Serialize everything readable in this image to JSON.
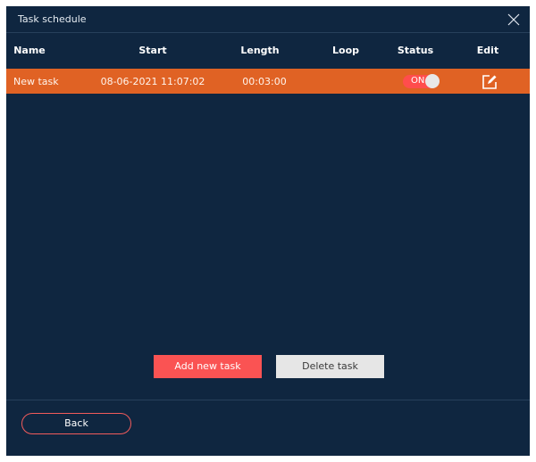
{
  "window": {
    "title": "Task schedule",
    "close_icon": "close-icon"
  },
  "table": {
    "columns": [
      "Name",
      "Start",
      "Length",
      "Loop",
      "Status",
      "Edit"
    ],
    "rows": [
      {
        "name": "New task",
        "start": "08-06-2021 11:07:02",
        "length": "00:03:00",
        "loop": "",
        "status": "ON",
        "edit_icon": "edit-icon"
      }
    ]
  },
  "actions": {
    "add_label": "Add new task",
    "delete_label": "Delete task"
  },
  "footer": {
    "back_label": "Back"
  },
  "colors": {
    "background": "#0f2640",
    "row_highlight": "#e06224",
    "accent": "#fa5353",
    "toggle_on": "#ff4d4d"
  }
}
